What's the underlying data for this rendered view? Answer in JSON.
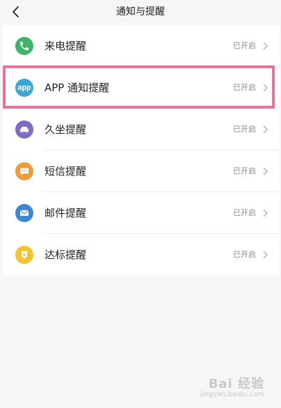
{
  "header": {
    "title": "通知与提醒"
  },
  "colors": {
    "call": "#3fb46a",
    "app": "#3fa7cf",
    "sedentary": "#7f6bc4",
    "sms": "#f09a3a",
    "mail": "#3e86d4",
    "goal": "#f3c22d",
    "highlight": "#e8729a"
  },
  "rows": [
    {
      "icon": "phone-icon",
      "label": "来电提醒",
      "status": "已开启"
    },
    {
      "icon": "app-icon",
      "icon_text": "app",
      "label": "APP 通知提醒",
      "status": "已开启"
    },
    {
      "icon": "sofa-icon",
      "label": "久坐提醒",
      "status": "已开启"
    },
    {
      "icon": "message-icon",
      "label": "短信提醒",
      "status": "已开启"
    },
    {
      "icon": "mail-icon",
      "label": "邮件提醒",
      "status": "已开启"
    },
    {
      "icon": "badge-icon",
      "label": "达标提醒",
      "status": "已开启"
    }
  ],
  "watermark": {
    "text": "Bai 经验",
    "sub": "jingyan.baidu.com"
  }
}
